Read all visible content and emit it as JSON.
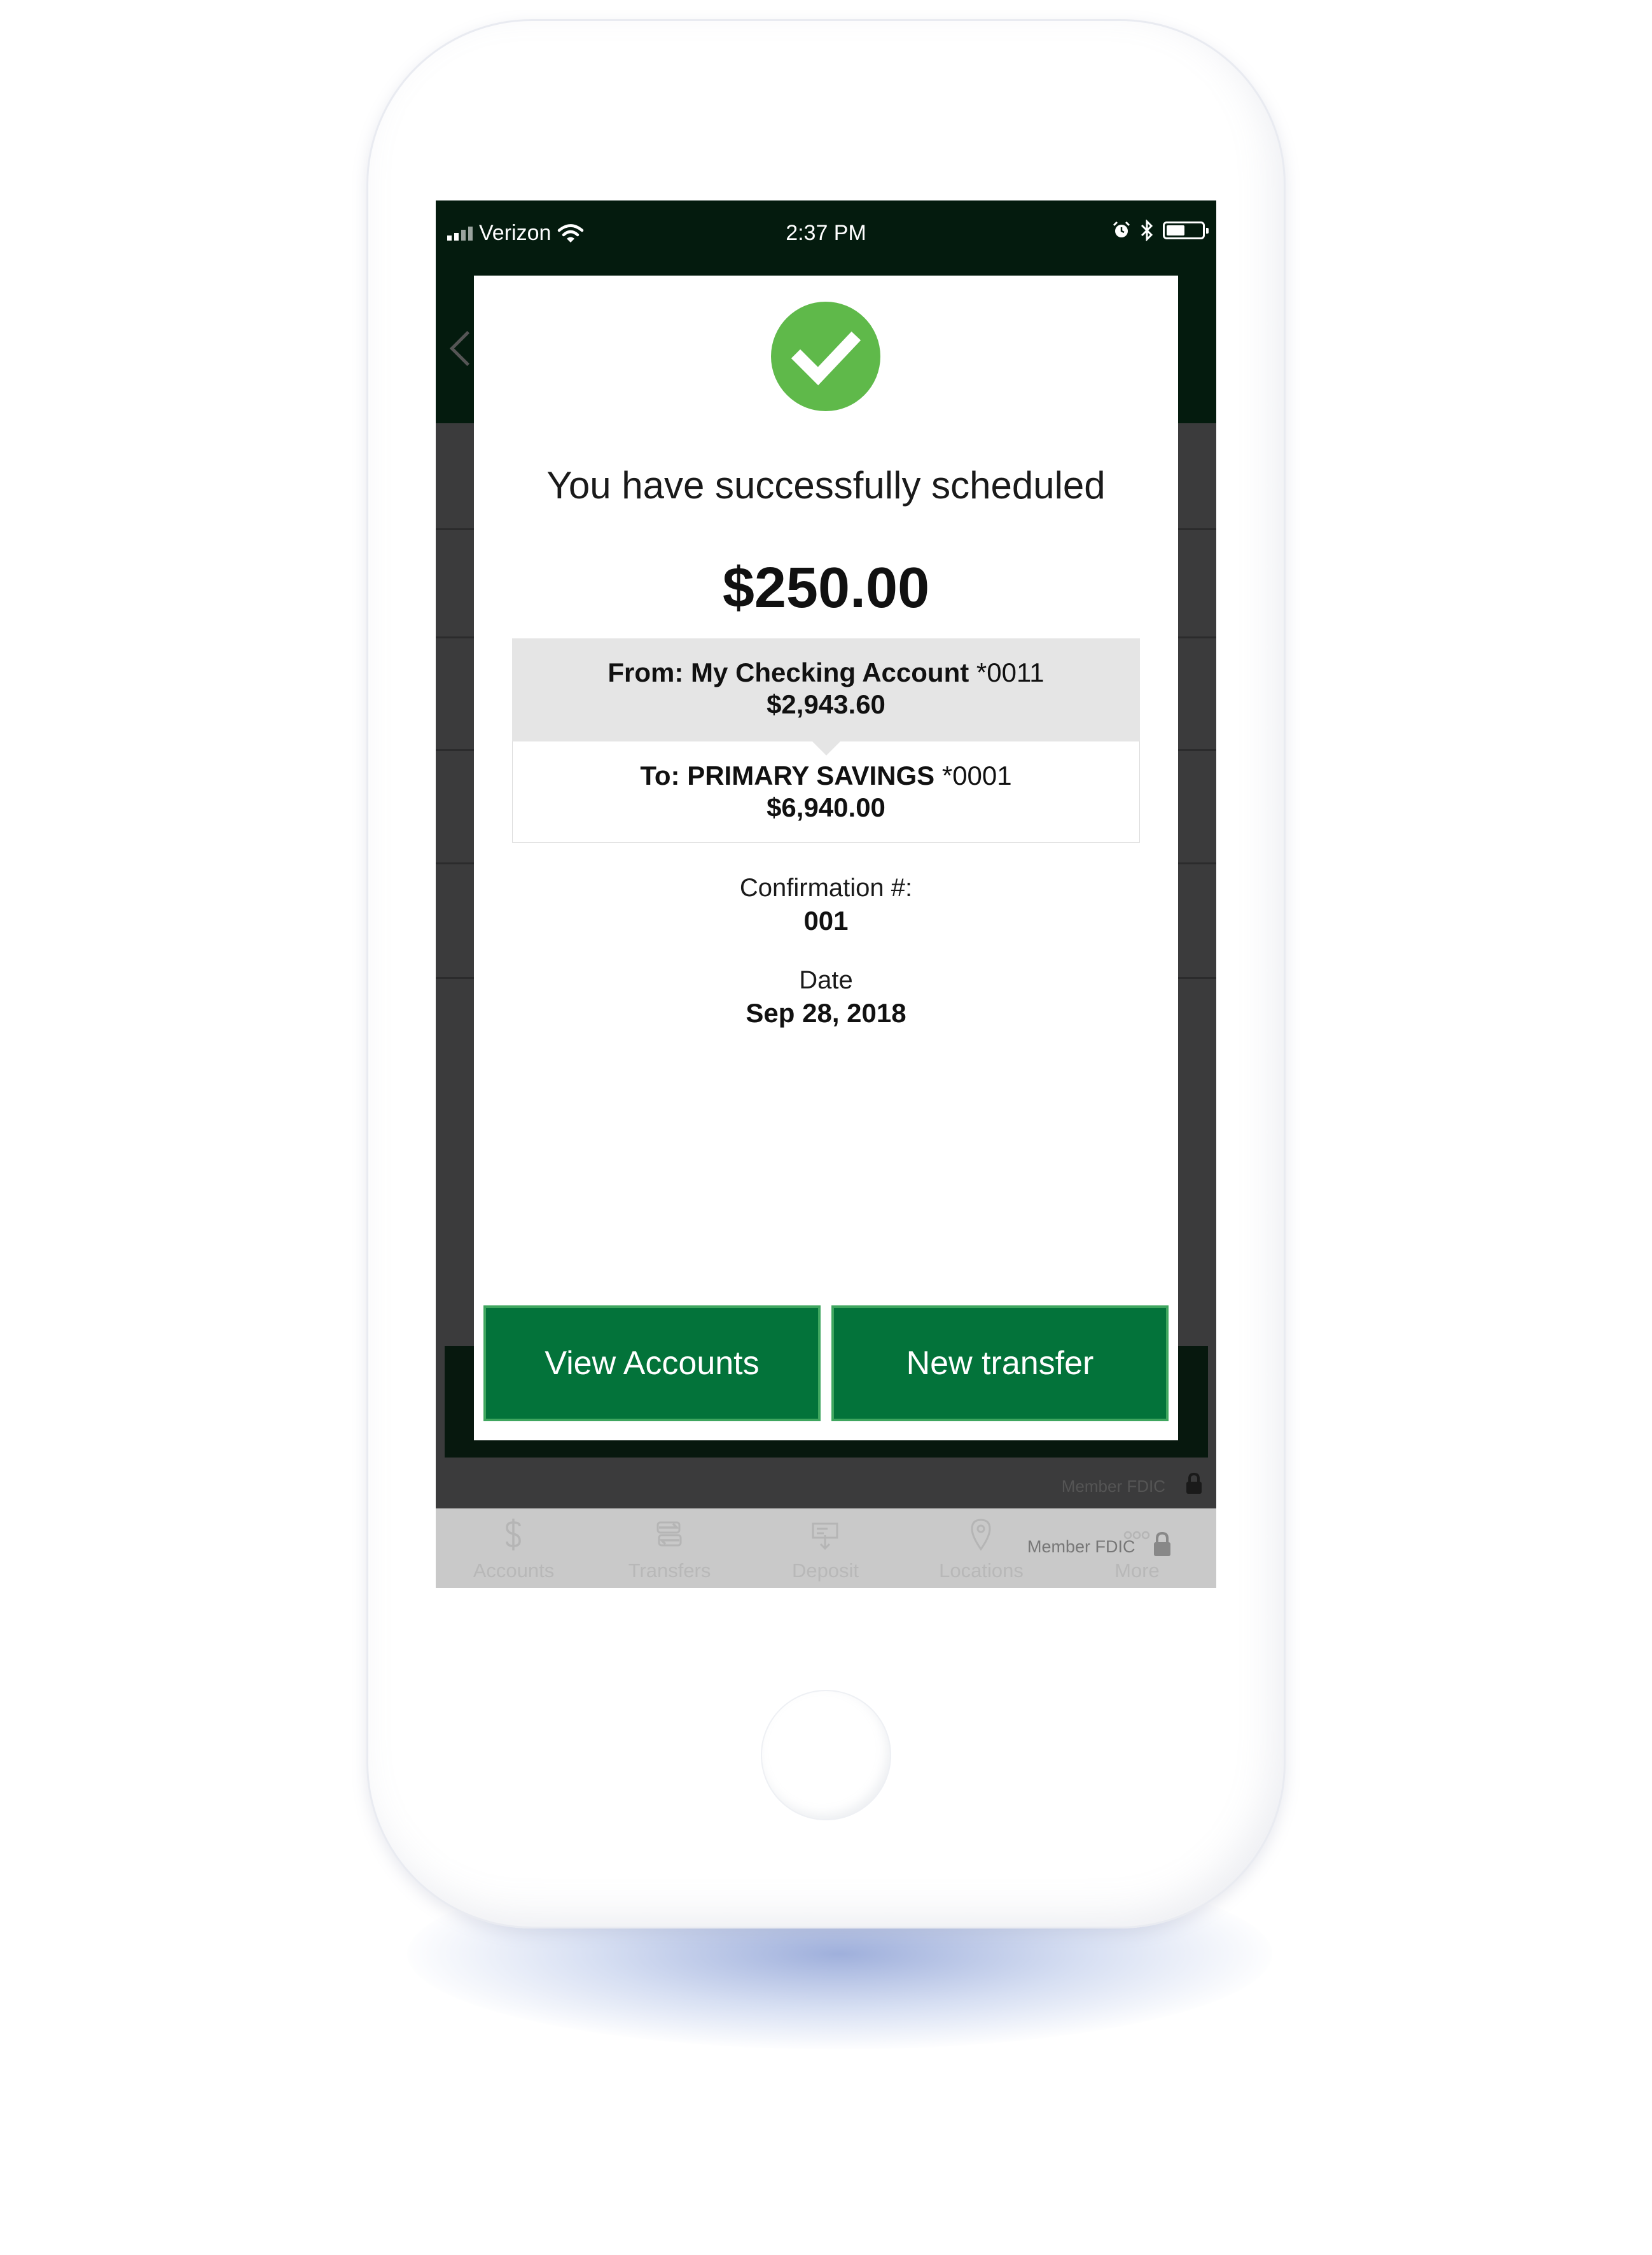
{
  "status_bar": {
    "carrier": "Verizon",
    "time": "2:37 PM"
  },
  "modal": {
    "headline": "You have successfully scheduled",
    "amount": "$250.00",
    "from": {
      "prefix": "From: My Checking Account",
      "account_suffix": "*0011",
      "balance": "$2,943.60"
    },
    "to": {
      "prefix": "To: PRIMARY SAVINGS",
      "account_suffix": "*0001",
      "balance": "$6,940.00"
    },
    "confirmation_label": "Confirmation #:",
    "confirmation_value": "001",
    "date_label": "Date",
    "date_value": "Sep 28, 2018",
    "buttons": {
      "view_accounts": "View Accounts",
      "new_transfer": "New transfer"
    }
  },
  "background": {
    "fdic_text": "Member FDIC"
  },
  "tab_bar": {
    "items": [
      {
        "label": "Accounts",
        "icon": "dollar-icon"
      },
      {
        "label": "Transfers",
        "icon": "transfer-arrows-icon"
      },
      {
        "label": "Deposit",
        "icon": "check-deposit-icon"
      },
      {
        "label": "Locations",
        "icon": "map-pin-icon"
      },
      {
        "label": "More",
        "icon": "more-dots-icon"
      }
    ],
    "fdic_text": "Member FDIC"
  },
  "colors": {
    "header_green": "#041b0e",
    "button_green": "#03733a",
    "success_green": "#5fb94a"
  }
}
